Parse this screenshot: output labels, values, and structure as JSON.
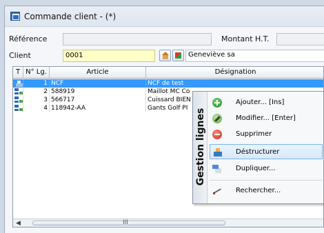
{
  "window": {
    "title": "Commande client -  (*)"
  },
  "form": {
    "reference_label": "Référence",
    "reference_value": "",
    "montant_label": "Montant H.T.",
    "client_label": "Client",
    "client_value": "0001",
    "client_name": "Geneviève sa"
  },
  "grid": {
    "columns": [
      "T",
      "N° Lg.",
      "Article",
      "Désignation"
    ],
    "rows": [
      {
        "type_icon": "person-icon",
        "num": "1",
        "article": "NCF",
        "designation": "NCF de test",
        "selected": true
      },
      {
        "type_icon": "document-icon",
        "num": "2",
        "article": "588919",
        "designation": "Maillot MC Co",
        "selected": false
      },
      {
        "type_icon": "document-icon",
        "num": "3",
        "article": "566717",
        "designation": "Cuissard BIEN",
        "selected": false
      },
      {
        "type_icon": "document-icon",
        "num": "4",
        "article": "118942-AA",
        "designation": "Gants Golf PI",
        "selected": false
      }
    ],
    "scroll_arrow": "◀",
    "scroll_grip": "III"
  },
  "context_menu": {
    "band_label": "Gestion lignes",
    "items": [
      {
        "label": "Ajouter... [Ins]",
        "icon": "add-icon"
      },
      {
        "label": "Modifier... [Enter]",
        "icon": "edit-icon"
      },
      {
        "label": "Supprimer",
        "icon": "delete-icon"
      },
      {
        "label": "Déstructurer",
        "icon": "restructure-icon"
      },
      {
        "label": "Dupliquer...",
        "icon": "duplicate-icon"
      },
      {
        "label": "Rechercher...",
        "icon": "search-icon"
      }
    ]
  }
}
